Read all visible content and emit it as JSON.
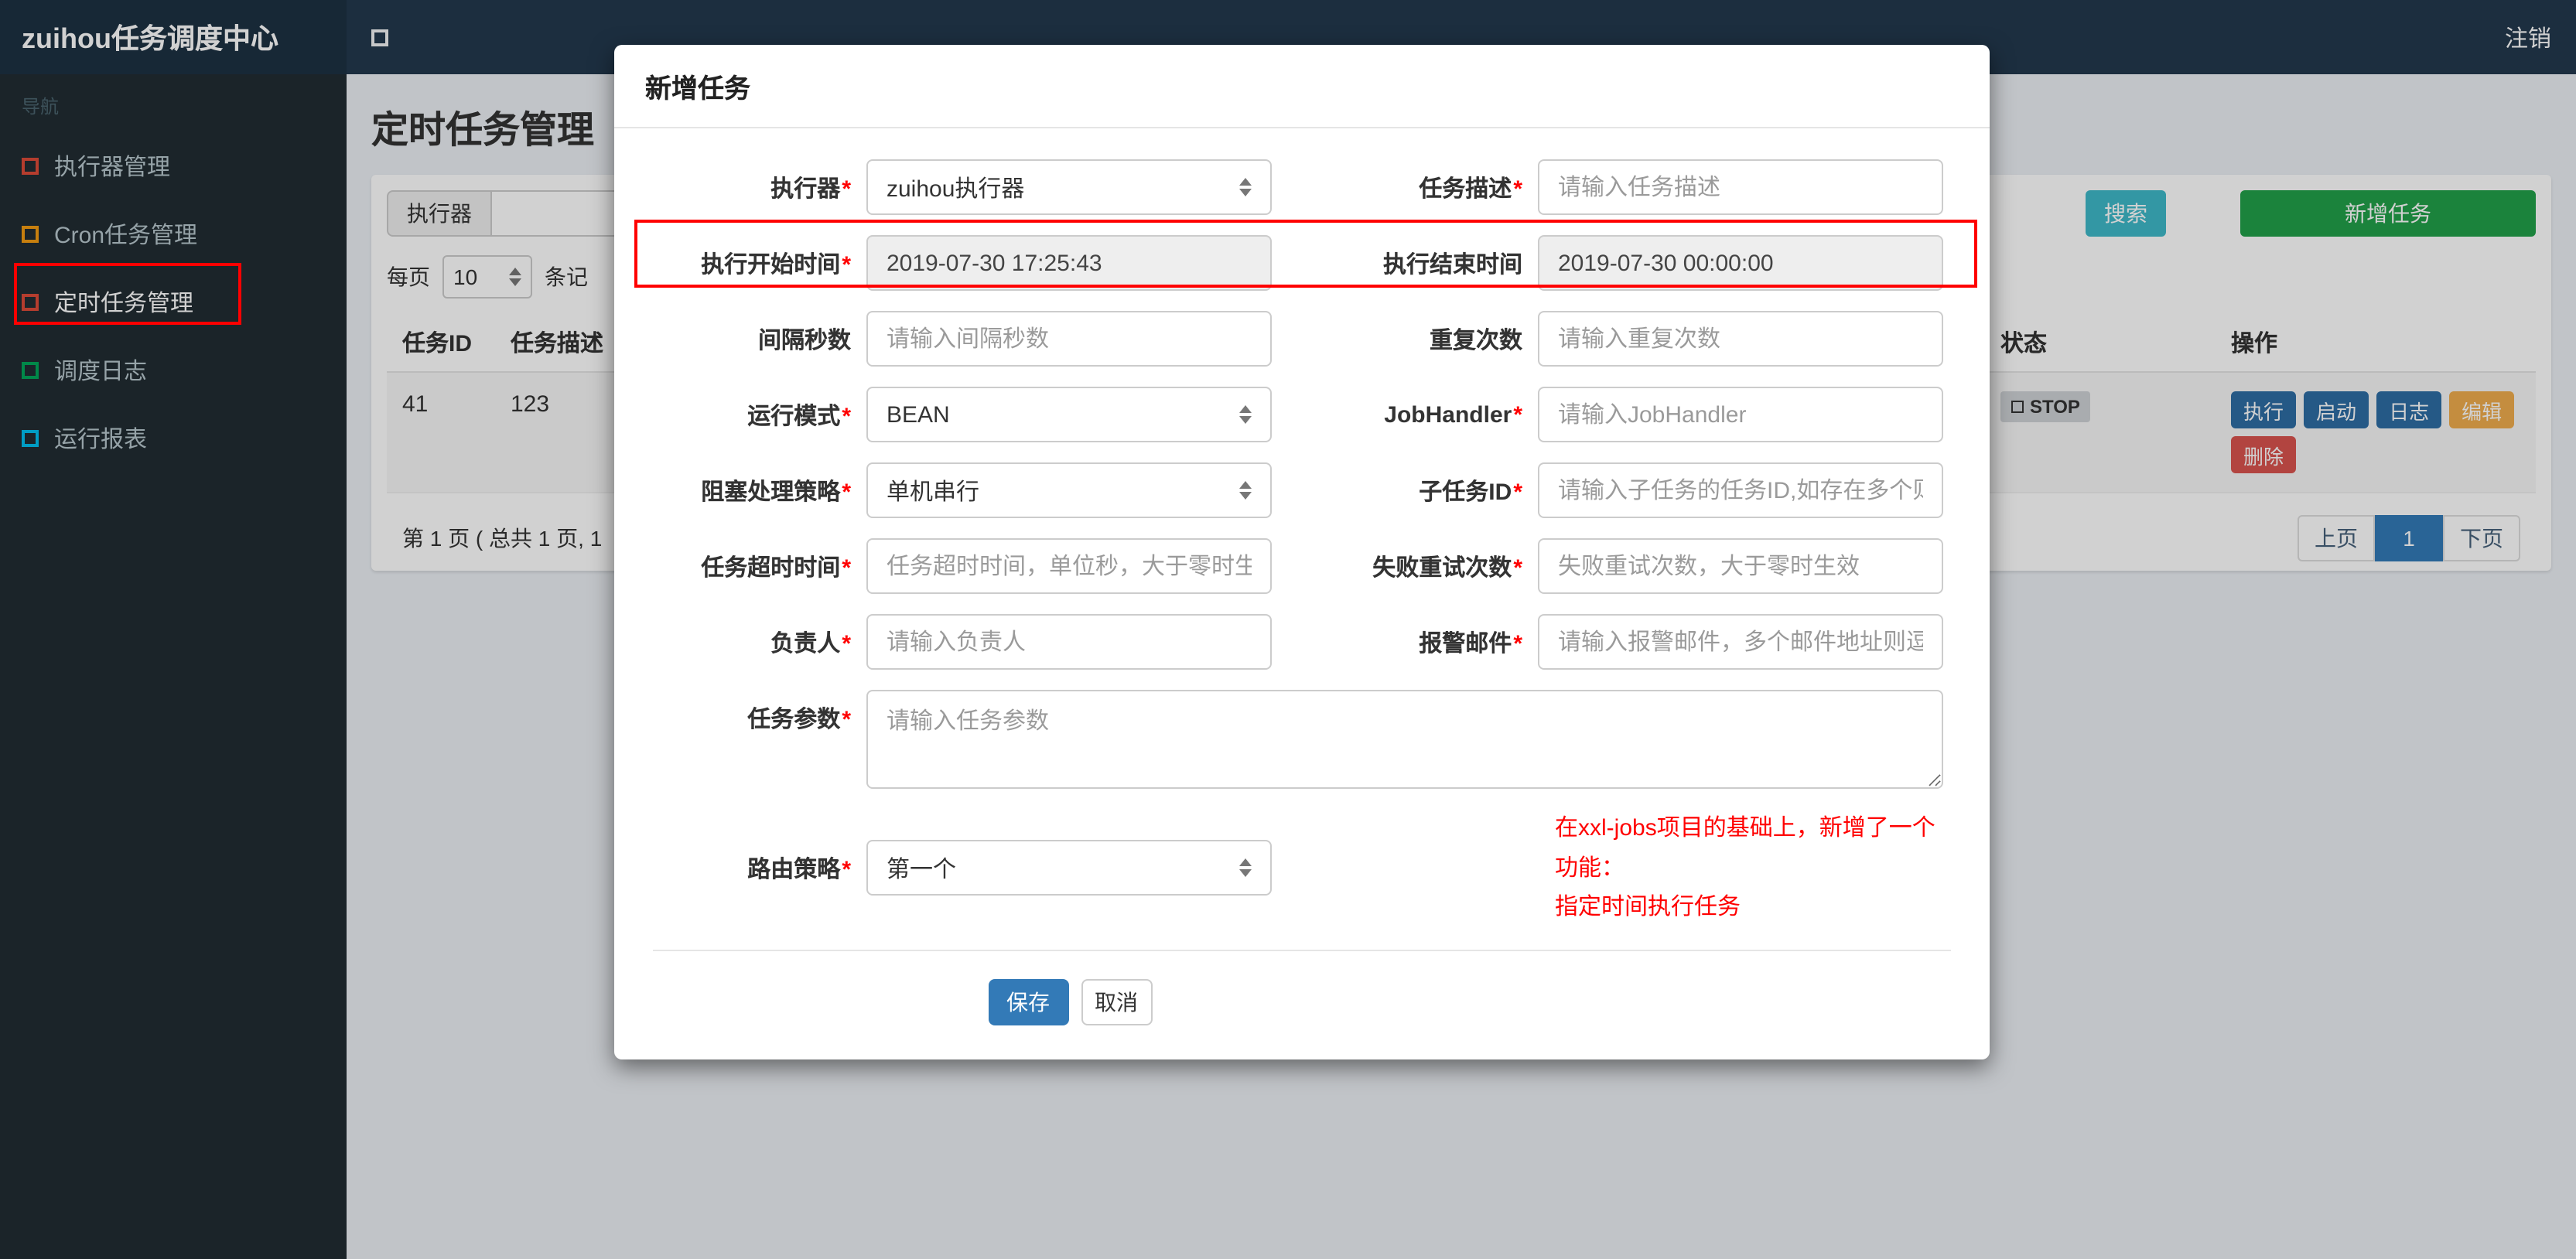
{
  "header": {
    "brand": "zuihou任务调度中心",
    "logout": "注销"
  },
  "sidebar": {
    "section_label": "导航",
    "items": [
      {
        "label": "执行器管理",
        "color": "#dd4b39"
      },
      {
        "label": "Cron任务管理",
        "color": "#f39c12"
      },
      {
        "label": "定时任务管理",
        "color": "#dd4b39",
        "active": "true"
      },
      {
        "label": "调度日志",
        "color": "#00a65a"
      },
      {
        "label": "运行报表",
        "color": "#00c0ef"
      }
    ]
  },
  "main": {
    "page_title": "定时任务管理",
    "filter": {
      "executor_label": "执行器",
      "search_button": "搜索",
      "add_button": "新增任务"
    },
    "page_size": {
      "prefix": "每页",
      "value": "10",
      "suffix": "条记"
    },
    "table": {
      "headers": {
        "id": "任务ID",
        "desc": "任务描述",
        "status": "状态",
        "ops": "操作"
      },
      "row": {
        "id": "41",
        "desc": "123",
        "status": "STOP",
        "op_run": "执行",
        "op_start": "启动",
        "op_log": "日志",
        "op_edit": "编辑",
        "op_delete": "删除"
      }
    },
    "pagination": {
      "summary": "第 1 页 ( 总共 1 页, 1",
      "prev": "上页",
      "current": "1",
      "next": "下页"
    }
  },
  "modal": {
    "title": "新增任务",
    "rows": [
      {
        "left": {
          "label": "执行器",
          "required": "*",
          "value": "zuihou执行器"
        },
        "right": {
          "label": "任务描述",
          "required": "*",
          "placeholder": "请输入任务描述"
        }
      },
      {
        "left": {
          "label": "执行开始时间",
          "required": "*",
          "value": "2019-07-30 17:25:43"
        },
        "right": {
          "label": "执行结束时间",
          "required": "",
          "value": "2019-07-30 00:00:00"
        }
      },
      {
        "left": {
          "label": "间隔秒数",
          "required": "",
          "placeholder": "请输入间隔秒数"
        },
        "right": {
          "label": "重复次数",
          "required": "",
          "placeholder": "请输入重复次数"
        }
      },
      {
        "left": {
          "label": "运行模式",
          "required": "*",
          "value": "BEAN"
        },
        "right": {
          "label": "JobHandler",
          "required": "*",
          "placeholder": "请输入JobHandler"
        }
      },
      {
        "left": {
          "label": "阻塞处理策略",
          "required": "*",
          "value": "单机串行"
        },
        "right": {
          "label": "子任务ID",
          "required": "*",
          "placeholder": "请输入子任务的任务ID,如存在多个则逗"
        }
      },
      {
        "left": {
          "label": "任务超时时间",
          "required": "*",
          "placeholder": "任务超时时间，单位秒，大于零时生效"
        },
        "right": {
          "label": "失败重试次数",
          "required": "*",
          "placeholder": "失败重试次数，大于零时生效"
        }
      },
      {
        "left": {
          "label": "负责人",
          "required": "*",
          "placeholder": "请输入负责人"
        },
        "right": {
          "label": "报警邮件",
          "required": "*",
          "placeholder": "请输入报警邮件，多个邮件地址则逗号分"
        }
      }
    ],
    "params": {
      "label": "任务参数",
      "required": "*",
      "placeholder": "请输入任务参数"
    },
    "route": {
      "label": "路由策略",
      "required": "*",
      "value": "第一个"
    },
    "note_line1": "在xxl-jobs项目的基础上，新增了一个功能：",
    "note_line2": "指定时间执行任务",
    "save_button": "保存",
    "cancel_button": "取消"
  },
  "colors": {
    "primary": "#337ab7",
    "success": "#22a04a",
    "info": "#3fb9c9",
    "warning": "#f0ad4e",
    "danger": "#d9534f",
    "annotation": "#ff0000",
    "navbar": "#23394e",
    "sidebar": "#222d32"
  }
}
